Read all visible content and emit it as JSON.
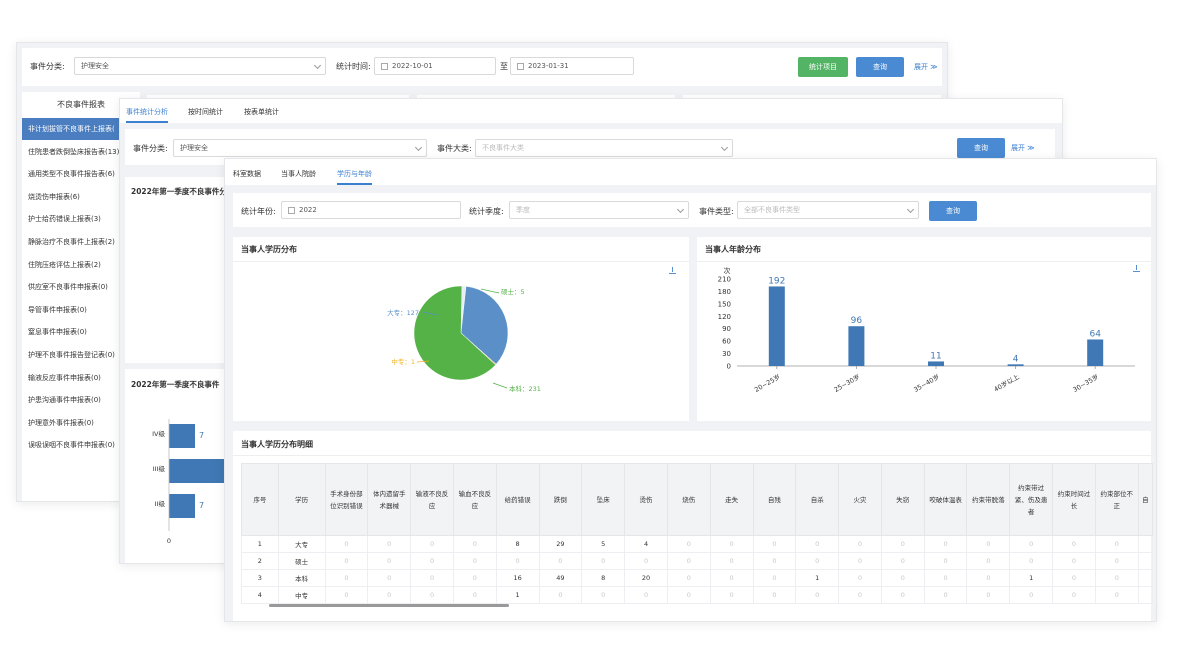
{
  "w1": {
    "event_category_label": "事件分类:",
    "event_category_value": "护理安全",
    "stat_time_label": "统计时间:",
    "date_from": "2022-10-01",
    "date_to_sep": "至",
    "date_to": "2023-01-31",
    "stat_items_button": "统计项目",
    "query_button": "查询",
    "expand_link": "展开",
    "list_title": "不良事件报表",
    "list_items": [
      "非计划拔管不良事件上报表(",
      "住院患者跌倒坠床报告表(13)",
      "通用类型不良事件报告表(6)",
      "烧烫伤申报表(6)",
      "护士给药错误上报表(3)",
      "静脉治疗不良事件上报表(2)",
      "住院压疮评估上报表(2)",
      "供应室不良事件申报表(0)",
      "导管事件申报表(0)",
      "窒息事件申报表(0)",
      "护理不良事件报告登记表(0)",
      "输液反应事件申报表(0)",
      "护患沟通事件申报表(0)",
      "护理意外事件报表(0)",
      "误吸误咽不良事件申报表(0)"
    ]
  },
  "w2": {
    "tabs": [
      "事件统计分析",
      "按时间统计",
      "按表单统计"
    ],
    "event_category_label": "事件分类:",
    "event_category_value": "护理安全",
    "event_major_label": "事件大类:",
    "event_major_placeholder": "不良事件大类",
    "query_button": "查询",
    "expand_link": "展开",
    "card1_title": "2022年第一季度不良事件分",
    "card2_title": "2022年第一季度不良事件",
    "bars": [
      {
        "label": "IV级",
        "value": 7
      },
      {
        "label": "III级",
        "value": null
      },
      {
        "label": "II级",
        "value": 7
      }
    ],
    "axis_zero": "0"
  },
  "w3": {
    "tabs": [
      "科室数据",
      "当事人院龄",
      "学历与年龄"
    ],
    "year_label": "统计年份:",
    "year_value": "2022",
    "quarter_label": "统计季度:",
    "quarter_placeholder": "季度",
    "event_type_label": "事件类型:",
    "event_type_placeholder": "全部不良事件类型",
    "query_button": "查询",
    "edu_title": "当事人学历分布",
    "age_title": "当事人年龄分布",
    "age_unit": "次",
    "detail_title": "当事人学历分布明细",
    "pie_labels": [
      "硕士：5",
      "大专：127",
      "中专：1",
      "本科：231"
    ],
    "table_headers": [
      "序号",
      "学历",
      "手术身份部位识别错误",
      "体内遗留手术器械",
      "输液不良反应",
      "输血不良反应",
      "给药错误",
      "跌倒",
      "坠床",
      "烫伤",
      "烧伤",
      "走失",
      "自残",
      "自杀",
      "火灾",
      "失窃",
      "咬破体温表",
      "约束带脱落",
      "约束带过紧、伤及患者",
      "约束时间过长",
      "约束部位不正",
      "自"
    ],
    "table_rows": [
      [
        "1",
        "大专",
        "0",
        "0",
        "0",
        "0",
        "8",
        "29",
        "5",
        "4",
        "0",
        "0",
        "0",
        "0",
        "0",
        "0",
        "0",
        "0",
        "0",
        "0",
        "0"
      ],
      [
        "2",
        "硕士",
        "0",
        "0",
        "0",
        "0",
        "0",
        "0",
        "0",
        "0",
        "0",
        "0",
        "0",
        "0",
        "0",
        "0",
        "0",
        "0",
        "0",
        "0",
        "0"
      ],
      [
        "3",
        "本科",
        "0",
        "0",
        "0",
        "0",
        "16",
        "49",
        "8",
        "20",
        "0",
        "0",
        "0",
        "1",
        "0",
        "0",
        "0",
        "0",
        "1",
        "0",
        "0"
      ],
      [
        "4",
        "中专",
        "0",
        "0",
        "0",
        "0",
        "1",
        "0",
        "0",
        "0",
        "0",
        "0",
        "0",
        "0",
        "0",
        "0",
        "0",
        "0",
        "0",
        "0",
        "0"
      ]
    ]
  },
  "chart_data": [
    {
      "type": "pie",
      "title": "当事人学历分布",
      "categories": [
        "硕士",
        "大专",
        "中专",
        "本科"
      ],
      "values": [
        5,
        127,
        1,
        231
      ],
      "colors": [
        "#e8eef5",
        "#5b8fc7",
        "#f0b429",
        "#54b246"
      ]
    },
    {
      "type": "bar",
      "title": "当事人年龄分布",
      "ylabel": "次",
      "categories": [
        "20~25岁",
        "25~30岁",
        "35~40岁",
        "40岁以上",
        "30~35岁"
      ],
      "values": [
        192,
        96,
        11,
        4,
        64
      ],
      "yticks": [
        0,
        30,
        60,
        90,
        120,
        150,
        180,
        210
      ],
      "ylim": [
        0,
        210
      ],
      "color": "#3f78b4"
    }
  ]
}
